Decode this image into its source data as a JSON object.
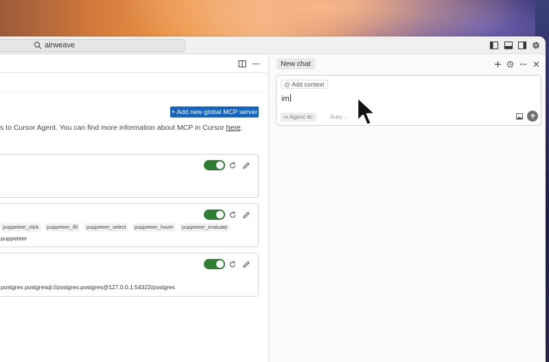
{
  "titlebar": {
    "search_text": "airweave"
  },
  "left_pane": {
    "add_server_label": "+ Add new global MCP server",
    "info_text": "s to Cursor Agent. You can find more information about MCP in Cursor",
    "info_link": "here",
    "info_suffix": ".",
    "servers": [
      {
        "enabled": true,
        "tools": [],
        "command": ""
      },
      {
        "enabled": true,
        "tools": [
          "puppeteer_click",
          "puppeteer_fill",
          "puppeteer_select",
          "puppeteer_hover",
          "puppeteer_evaluate"
        ],
        "command": "puppeteer"
      },
      {
        "enabled": true,
        "tools": [],
        "command": "postgres postgresql://postgres:postgres@127.0.0.1:54322/postgres"
      }
    ]
  },
  "chat": {
    "tab_label": "New chat",
    "add_context_label": "Add context",
    "input_value": "im",
    "agent_label": "Agent",
    "agent_shortcut": "⌘I",
    "model_label": "Auto",
    "model_chevron": "⌄"
  },
  "colors": {
    "accent": "#1763c2",
    "toggle_on": "#2f7d32",
    "send_button": "#6f6f6f"
  },
  "icons": {
    "search": "search-icon",
    "toggle_left_sidebar": "panel-left-icon",
    "toggle_bottom_panel": "panel-bottom-icon",
    "toggle_right_sidebar": "panel-right-icon",
    "settings": "gear-icon",
    "split_editor": "split-editor-icon",
    "more": "ellipsis-icon",
    "new_chat": "plus-icon",
    "history": "history-icon",
    "close": "close-icon",
    "refresh": "refresh-icon",
    "edit": "pencil-icon",
    "image": "image-icon",
    "send": "arrow-up-icon",
    "cursor": "mouse-pointer-icon"
  }
}
